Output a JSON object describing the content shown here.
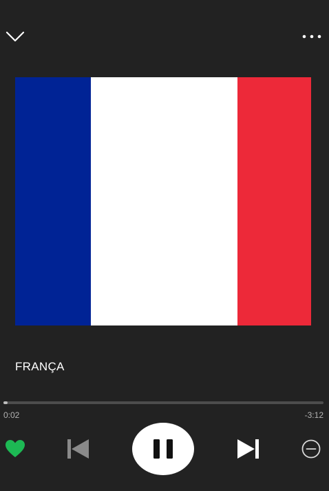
{
  "header": {
    "collapse_icon": "chevron-down-icon",
    "more_icon": "more-options-icon"
  },
  "artwork": {
    "description_colors": {
      "blue": "#002395",
      "white": "#ffffff",
      "red": "#ED2939"
    }
  },
  "track": {
    "title": "FRANÇA"
  },
  "playback": {
    "progress_fraction": 0.012,
    "elapsed": "0:02",
    "remaining": "-3:12"
  },
  "controls": {
    "like_icon": "heart-icon",
    "previous_icon": "skip-previous-icon",
    "pause_icon": "pause-icon",
    "next_icon": "skip-next-icon",
    "remove_icon": "minus-circle-icon"
  },
  "colors": {
    "background": "#222222",
    "accent_green": "#1DB954",
    "progress_track": "#4d4d4d",
    "progress_fill": "#bdbdbd"
  }
}
